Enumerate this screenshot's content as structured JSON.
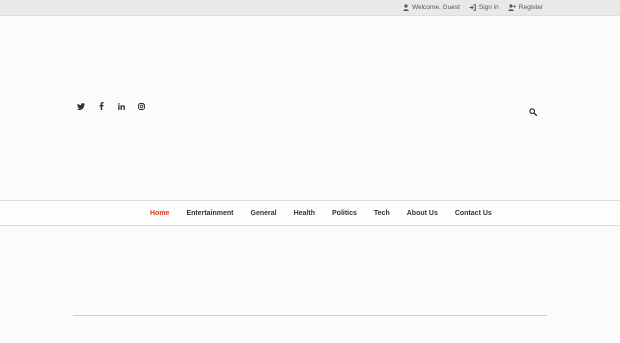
{
  "topbar": {
    "welcome": "Welcome, Guest",
    "signin": "Sign in",
    "register": "Register"
  },
  "social": [
    "twitter-icon",
    "facebook-icon",
    "linkedin-icon",
    "instagram-icon"
  ],
  "nav": {
    "items": [
      "Home",
      "Entertainment",
      "General",
      "Health",
      "Politics",
      "Tech",
      "About Us",
      "Contact Us"
    ],
    "active": "Home"
  },
  "colors": {
    "accent": "#d4401f",
    "topbar_bg": "#e9e9e9",
    "text": "#333333"
  }
}
